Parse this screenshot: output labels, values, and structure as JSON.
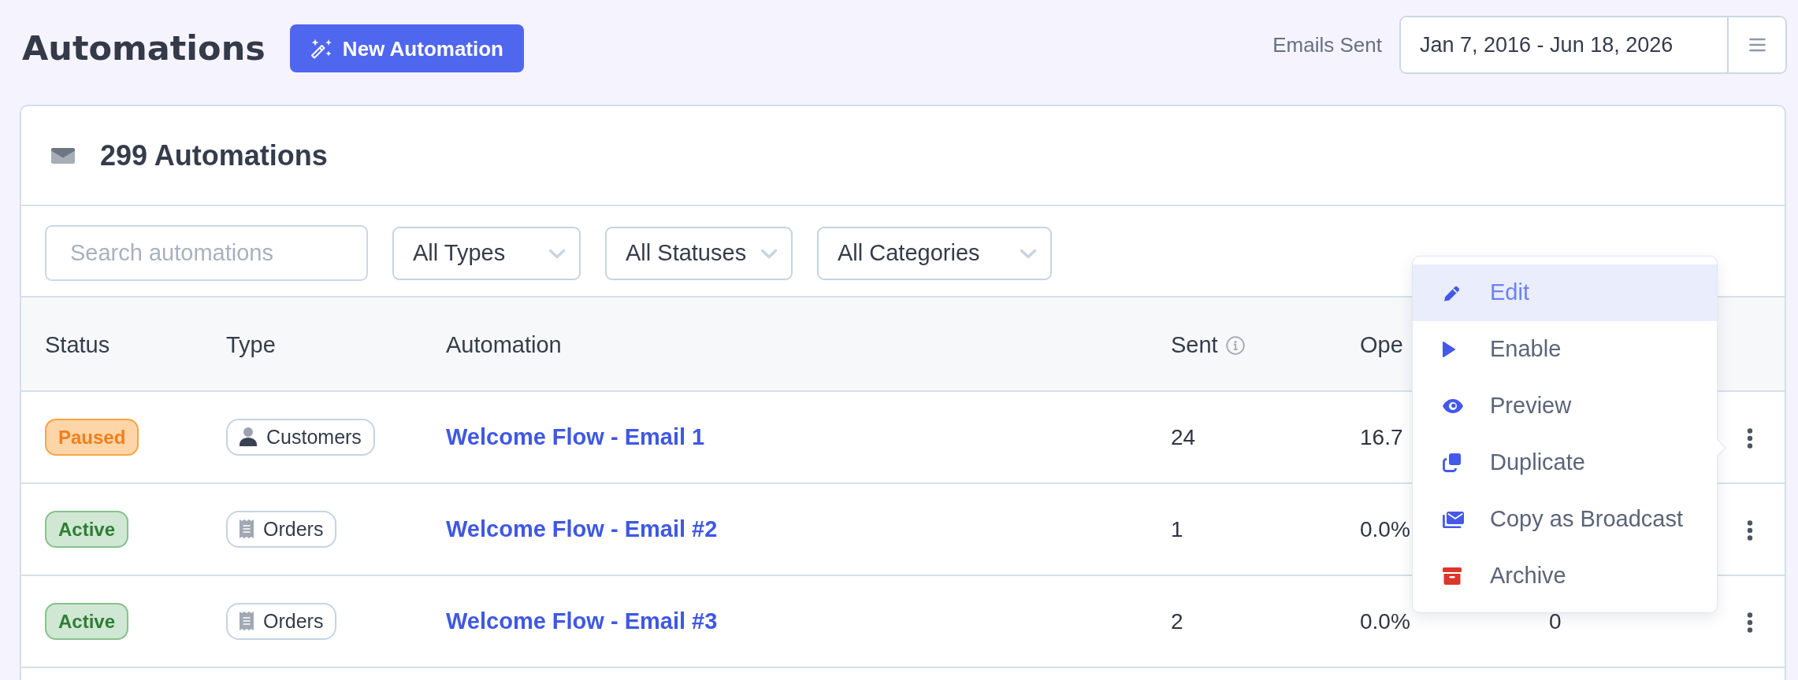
{
  "header": {
    "title": "Automations",
    "new_button": "New Automation",
    "emails_label": "Emails Sent",
    "date_range": "Jan 7, 2016 - Jun 18, 2026"
  },
  "card": {
    "title": "299 Automations"
  },
  "filters": {
    "search": {
      "placeholder": "Search automations"
    },
    "selects": [
      {
        "value": "All Types"
      },
      {
        "value": "All Statuses"
      },
      {
        "value": "All Categories"
      }
    ]
  },
  "table": {
    "columns": [
      {
        "label": "Status",
        "info": false
      },
      {
        "label": "Type",
        "info": false
      },
      {
        "label": "Automation",
        "info": false
      },
      {
        "label": "Sent",
        "info": true
      },
      {
        "label": "Ope",
        "info": false
      }
    ],
    "rows": [
      {
        "status": {
          "label": "Paused",
          "kind": "paused"
        },
        "type": {
          "label": "Customers",
          "kind": "customers"
        },
        "automation": "Welcome Flow - Email 1",
        "sent": "24",
        "column_5": "16.7"
      },
      {
        "status": {
          "label": "Active",
          "kind": "active"
        },
        "type": {
          "label": "Orders",
          "kind": "orders"
        },
        "automation": "Welcome Flow - Email #2",
        "sent": "1",
        "column_5": "0.0%"
      },
      {
        "status": {
          "label": "Active",
          "kind": "active"
        },
        "type": {
          "label": "Orders",
          "kind": "orders"
        },
        "automation": "Welcome Flow - Email #3",
        "sent": "2",
        "column_5": "0.0%",
        "column_6": "0"
      }
    ]
  },
  "row_menu": {
    "items": [
      {
        "label": "Edit",
        "selected": true,
        "color": "#4459e8"
      },
      {
        "label": "Enable",
        "selected": false,
        "color": "#4459e8"
      },
      {
        "label": "Preview",
        "selected": false,
        "color": "#4459e8"
      },
      {
        "label": "Duplicate",
        "selected": false,
        "color": "#4459e8"
      },
      {
        "label": "Copy as Broadcast",
        "selected": false,
        "color": "#4459e8"
      },
      {
        "label": "Archive",
        "selected": false,
        "color": "#d9382c"
      }
    ]
  }
}
